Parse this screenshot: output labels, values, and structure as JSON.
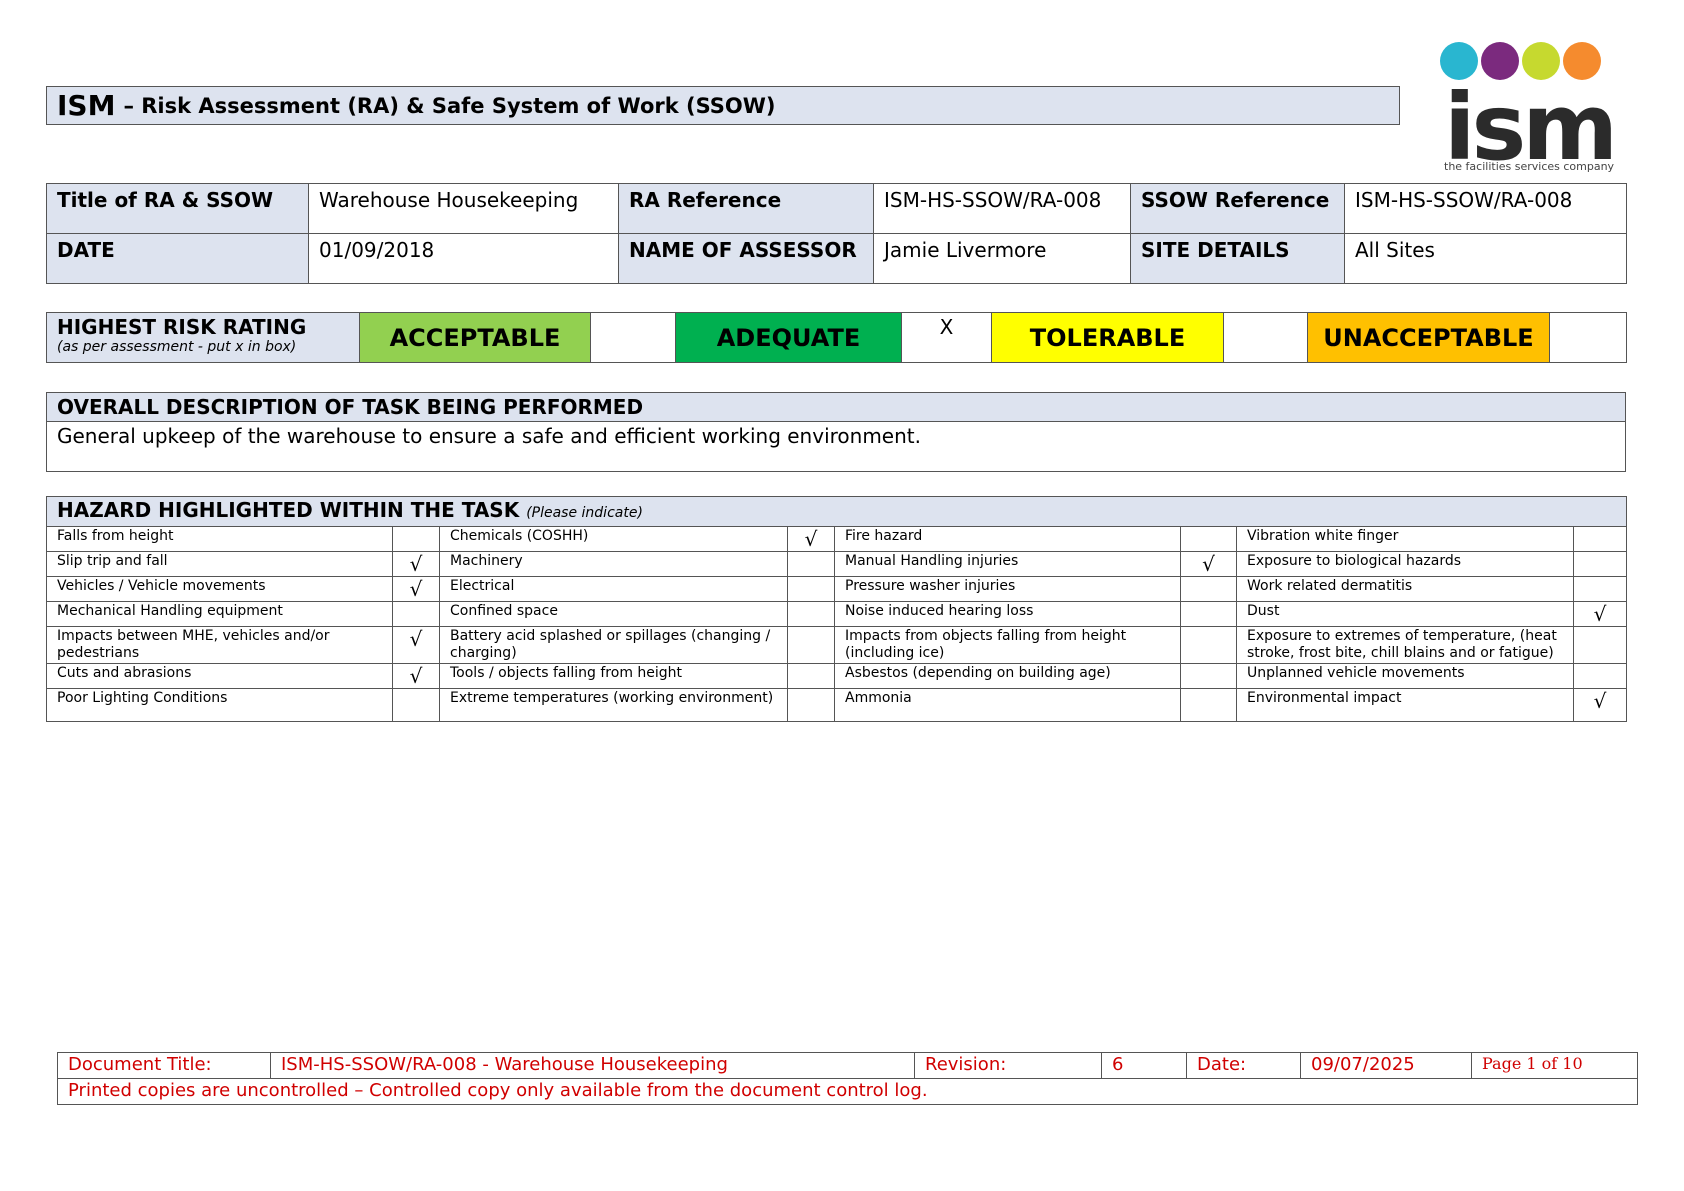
{
  "header": {
    "title_main": "ISM",
    "title_rest": "– Risk Assessment (RA) & Safe System of Work (SSOW)"
  },
  "logo": {
    "word": "ism",
    "tagline": "the facilities services company",
    "dot_colors": [
      "#29b6d0",
      "#7b2a7e",
      "#c6d92f",
      "#f58b2e"
    ]
  },
  "info": {
    "title_label": "Title of RA & SSOW",
    "title_value": "Warehouse Housekeeping",
    "ra_ref_label": "RA Reference",
    "ra_ref_value": "ISM-HS-SSOW/RA-008",
    "ssow_ref_label": "SSOW Reference",
    "ssow_ref_value": "ISM-HS-SSOW/RA-008",
    "date_label": "DATE",
    "date_value": "01/09/2018",
    "assessor_label": "NAME OF ASSESSOR",
    "assessor_value": "Jamie Livermore",
    "site_label": "SITE DETAILS",
    "site_value": "All Sites"
  },
  "risk": {
    "label": "HIGHEST RISK RATING",
    "sublabel": "(as per assessment - put x in box)",
    "levels": [
      {
        "name": "ACCEPTABLE",
        "color": "#92d050",
        "mark": ""
      },
      {
        "name": "ADEQUATE",
        "color": "#00b050",
        "mark": "X"
      },
      {
        "name": "TOLERABLE",
        "color": "#ffff00",
        "mark": ""
      },
      {
        "name": "UNACCEPTABLE",
        "color": "#ffc000",
        "mark": ""
      }
    ]
  },
  "description": {
    "heading": "OVERALL DESCRIPTION OF TASK BEING PERFORMED",
    "text": "General upkeep of the warehouse to ensure a safe and efficient working environment."
  },
  "hazards": {
    "heading": "HAZARD HIGHLIGHTED WITHIN THE TASK",
    "hint": "(Please indicate)",
    "rows": [
      [
        [
          "Falls from height",
          ""
        ],
        [
          "Chemicals (COSHH)",
          "√"
        ],
        [
          "Fire hazard",
          ""
        ],
        [
          "Vibration white finger",
          ""
        ]
      ],
      [
        [
          "Slip trip and fall",
          "√"
        ],
        [
          "Machinery",
          ""
        ],
        [
          "Manual Handling injuries",
          "√"
        ],
        [
          "Exposure to biological hazards",
          ""
        ]
      ],
      [
        [
          "Vehicles / Vehicle movements",
          "√"
        ],
        [
          "Electrical",
          ""
        ],
        [
          "Pressure washer injuries",
          ""
        ],
        [
          "Work related dermatitis",
          ""
        ]
      ],
      [
        [
          "Mechanical Handling equipment",
          ""
        ],
        [
          "Confined space",
          ""
        ],
        [
          "Noise induced hearing loss",
          ""
        ],
        [
          "Dust",
          "√"
        ]
      ],
      [
        [
          "Impacts between MHE, vehicles and/or pedestrians",
          "√"
        ],
        [
          "Battery acid splashed or spillages (changing / charging)",
          ""
        ],
        [
          "Impacts from objects falling from height (including ice)",
          ""
        ],
        [
          "Exposure to extremes of temperature, (heat stroke, frost bite, chill blains and or fatigue)",
          ""
        ]
      ],
      [
        [
          "Cuts and abrasions",
          "√"
        ],
        [
          "Tools / objects falling from height",
          ""
        ],
        [
          "Asbestos (depending on building age)",
          ""
        ],
        [
          "Unplanned vehicle movements",
          ""
        ]
      ],
      [
        [
          "Poor Lighting Conditions",
          ""
        ],
        [
          "Extreme temperatures (working environment)",
          ""
        ],
        [
          "Ammonia",
          ""
        ],
        [
          "Environmental impact",
          "√"
        ]
      ]
    ]
  },
  "footer": {
    "doc_title_label": "Document Title:",
    "doc_title_value": "ISM-HS-SSOW/RA-008 - Warehouse Housekeeping",
    "revision_label": "Revision:",
    "revision_value": "6",
    "date_label": "Date:",
    "date_value": "09/07/2025",
    "page": "Page 1 of 10",
    "notice": "Printed copies are uncontrolled – Controlled copy only available from the document control log."
  }
}
